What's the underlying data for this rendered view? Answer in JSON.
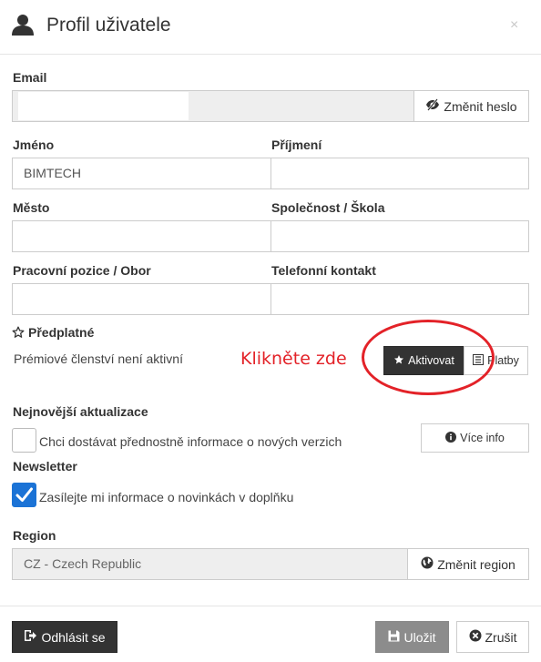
{
  "header": {
    "title": "Profil uživatele",
    "close_glyph": "×"
  },
  "email": {
    "label": "Email",
    "value": "",
    "change_password_label": "Změnit heslo"
  },
  "first_name": {
    "label": "Jméno",
    "value": "BIMTECH"
  },
  "last_name": {
    "label": "Příjmení",
    "value": ""
  },
  "city": {
    "label": "Město",
    "value": ""
  },
  "company": {
    "label": "Společnost / Škola",
    "value": ""
  },
  "position": {
    "label": "Pracovní pozice / Obor",
    "value": ""
  },
  "phone": {
    "label": "Telefonní kontakt",
    "value": ""
  },
  "subscription": {
    "label": "Předplatné",
    "status_text": "Prémiové členství není aktivní",
    "activate_label": "Aktivovat",
    "payments_label": "Platby"
  },
  "annotation": {
    "text": "Klikněte zde",
    "color": "#e32228"
  },
  "updates": {
    "label": "Nejnovější aktualizace",
    "checkbox_text": "Chci dostávat přednostně informace o nových verzich",
    "checked": false,
    "more_info_label": "Více info"
  },
  "newsletter": {
    "label": "Newsletter",
    "checkbox_text": "Zasílejte mi informace o novinkách v doplňku",
    "checked": true
  },
  "region": {
    "label": "Region",
    "value": "CZ - Czech Republic",
    "change_label": "Změnit region"
  },
  "footer": {
    "logout_label": "Odhlásit se",
    "save_label": "Uložit",
    "cancel_label": "Zrušit"
  },
  "colors": {
    "accent": "#1b73d6",
    "dark_button": "#333333",
    "disabled_button": "#8c8c8c",
    "annotation": "#e32228"
  },
  "icons": {
    "header": "user-icon",
    "change_password": "eye-slash-icon",
    "subscription": "star-outline-icon",
    "activate": "star-icon",
    "payments": "list-icon",
    "more_info": "info-circle-icon",
    "region": "globe-icon",
    "logout": "sign-out-icon",
    "save": "floppy-icon",
    "cancel": "times-circle-icon"
  }
}
